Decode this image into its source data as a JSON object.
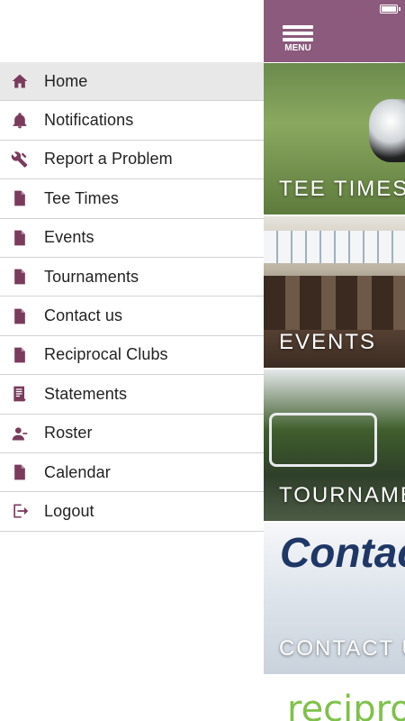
{
  "drawer": {
    "items": [
      {
        "label": "Home",
        "icon": "home-icon",
        "active": true
      },
      {
        "label": "Notifications",
        "icon": "bell-icon"
      },
      {
        "label": "Report a Problem",
        "icon": "tools-icon"
      },
      {
        "label": "Tee Times",
        "icon": "document-icon"
      },
      {
        "label": "Events",
        "icon": "document-icon"
      },
      {
        "label": "Tournaments",
        "icon": "document-icon"
      },
      {
        "label": "Contact us",
        "icon": "document-icon"
      },
      {
        "label": "Reciprocal Clubs",
        "icon": "document-icon"
      },
      {
        "label": "Statements",
        "icon": "statement-icon"
      },
      {
        "label": "Roster",
        "icon": "roster-icon"
      },
      {
        "label": "Calendar",
        "icon": "document-icon"
      },
      {
        "label": "Logout",
        "icon": "logout-icon"
      }
    ]
  },
  "topbar": {
    "menu_label": "MENU"
  },
  "tiles": [
    {
      "title": "TEE TIMES"
    },
    {
      "title": "EVENTS"
    },
    {
      "title": "TOURNAMENTS"
    },
    {
      "title": "CONTACT US",
      "image_text": "Contac"
    },
    {
      "image_text": "recipro"
    }
  ],
  "colors": {
    "accent": "#8b5a7c",
    "icon": "#7a3b5d",
    "active_row": "#e8e8e8"
  }
}
